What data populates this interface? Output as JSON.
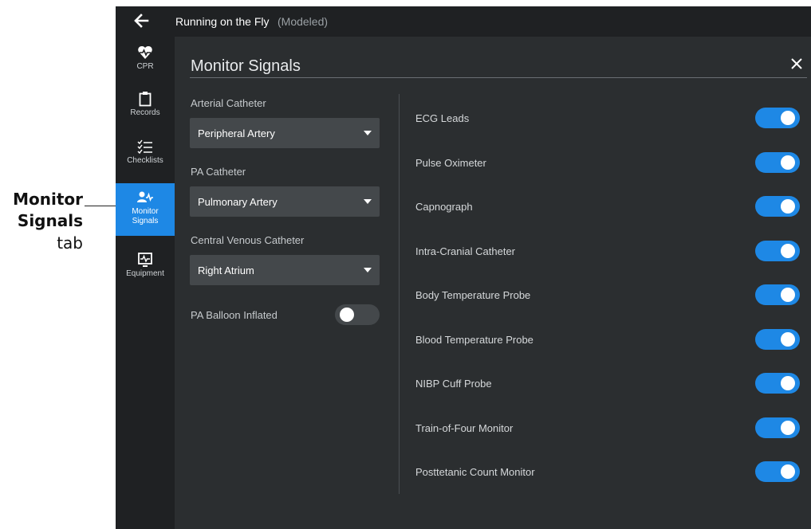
{
  "callout": {
    "line1": "Monitor",
    "line2": "Signals",
    "line3": "tab"
  },
  "topbar": {
    "title": "Running on the Fly",
    "subtitle": "(Modeled)"
  },
  "sidebar": {
    "items": [
      {
        "label": "CPR",
        "icon": "heart-pulse-icon"
      },
      {
        "label": "Records",
        "icon": "clipboard-icon"
      },
      {
        "label": "Checklists",
        "icon": "checklist-icon"
      },
      {
        "label1": "Monitor",
        "label2": "Signals",
        "icon": "person-pulse-icon",
        "active": true
      },
      {
        "label": "Equipment",
        "icon": "monitor-icon"
      }
    ]
  },
  "panel": {
    "title": "Monitor Signals",
    "left": {
      "arterial": {
        "label": "Arterial Catheter",
        "value": "Peripheral Artery"
      },
      "pa": {
        "label": "PA Catheter",
        "value": "Pulmonary Artery"
      },
      "cvc": {
        "label": "Central Venous Catheter",
        "value": "Right Atrium"
      },
      "balloon": {
        "label": "PA Balloon Inflated",
        "on": false
      }
    },
    "signals": [
      {
        "label": "ECG Leads",
        "on": true
      },
      {
        "label": "Pulse Oximeter",
        "on": true
      },
      {
        "label": "Capnograph",
        "on": true
      },
      {
        "label": "Intra-Cranial Catheter",
        "on": true
      },
      {
        "label": "Body Temperature Probe",
        "on": true
      },
      {
        "label": "Blood Temperature Probe",
        "on": true
      },
      {
        "label": "NIBP Cuff Probe",
        "on": true
      },
      {
        "label": "Train-of-Four Monitor",
        "on": true
      },
      {
        "label": "Posttetanic Count Monitor",
        "on": true
      }
    ]
  },
  "colors": {
    "accent": "#1e88e5",
    "background": "#2b2e30",
    "sidebar": "#1f2123"
  }
}
